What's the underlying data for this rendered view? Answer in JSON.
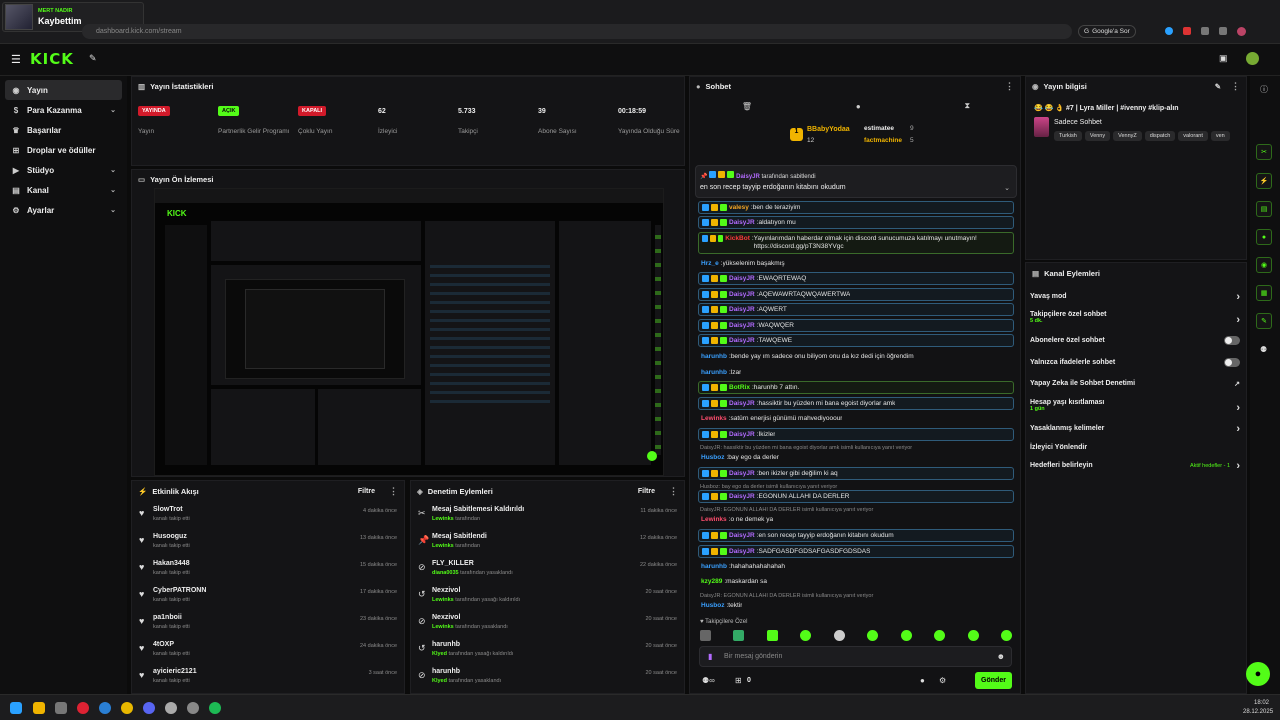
{
  "browser": {
    "url": "dashboard.kick.com/stream",
    "google_btn": "Google'a Sor",
    "media_card": {
      "artist": "MERT NADIR",
      "track": "Kaybettim"
    }
  },
  "topbar": {
    "logo": "KICK"
  },
  "sidebar": {
    "items": [
      {
        "label": "Yayın",
        "icon": "broadcast-icon",
        "active": true
      },
      {
        "label": "Para Kazanma",
        "icon": "dollar-icon",
        "chevron": true
      },
      {
        "label": "Başarılar",
        "icon": "trophy-icon"
      },
      {
        "label": "Droplar ve ödüller",
        "icon": "gift-icon"
      },
      {
        "label": "Stüdyo",
        "icon": "studio-icon",
        "chevron": true
      },
      {
        "label": "Kanal",
        "icon": "channel-icon",
        "chevron": true
      },
      {
        "label": "Ayarlar",
        "icon": "gear-icon",
        "chevron": true
      }
    ]
  },
  "stats": {
    "title": "Yayın İstatistikleri",
    "items": [
      {
        "value": "YAYINDA",
        "label": "Yayın",
        "badge": "red"
      },
      {
        "value": "AÇIK",
        "label": "Partnerlik Gelir Programı",
        "badge": "green"
      },
      {
        "value": "KAPALI",
        "label": "Çoklu Yayın",
        "badge": "red"
      },
      {
        "value": "62",
        "label": "İzleyici"
      },
      {
        "value": "5.733",
        "label": "Takipçi"
      },
      {
        "value": "39",
        "label": "Abone Sayısı"
      },
      {
        "value": "00:18:59",
        "label": "Yayında Olduğu Süre"
      }
    ]
  },
  "preview": {
    "title": "Yayın Ön İzlemesi"
  },
  "activity": {
    "title": "Etkinlik Akışı",
    "filter": "Filtre",
    "rows": [
      {
        "name": "SlowTrot",
        "sub": "kanalı takip etti",
        "time": "4 dakika önce"
      },
      {
        "name": "Husooguz",
        "sub": "kanalı takip etti",
        "time": "13 dakika önce"
      },
      {
        "name": "Hakan3448",
        "sub": "kanalı takip etti",
        "time": "15 dakika önce"
      },
      {
        "name": "CyberPATRONN",
        "sub": "kanalı takip etti",
        "time": "17 dakika önce"
      },
      {
        "name": "pa1nboii",
        "sub": "kanalı takip etti",
        "time": "23 dakika önce"
      },
      {
        "name": "4tOXP",
        "sub": "kanalı takip etti",
        "time": "24 dakika önce"
      },
      {
        "name": "ayicieric2121",
        "sub": "kanalı takip etti",
        "time": "3 saat önce"
      }
    ]
  },
  "moderation": {
    "title": "Denetim Eylemleri",
    "filter": "Filtre",
    "rows": [
      {
        "icon": "pin-off-icon",
        "title": "Mesaj Sabitlemesi Kaldırıldı",
        "user": "Lewinks",
        "sub": "tarafından",
        "time": "11 dakika önce"
      },
      {
        "icon": "pin-icon",
        "title": "Mesaj Sabitlendi",
        "user": "Lewinks",
        "sub": "tarafından",
        "time": "12 dakika önce"
      },
      {
        "icon": "ban-icon",
        "title": "FLY_KILLER",
        "user": "diana0035",
        "sub": "tarafından yasaklandı",
        "time": "22 dakika önce"
      },
      {
        "icon": "undo-icon",
        "title": "Nexzivol",
        "user": "Lewinks",
        "sub": "tarafından yasağı kaldırıldı",
        "time": "20 saat önce"
      },
      {
        "icon": "ban-icon",
        "title": "Nexzivol",
        "user": "Lewinks",
        "sub": "tarafından yasaklandı",
        "time": "20 saat önce"
      },
      {
        "icon": "undo-icon",
        "title": "harunhb",
        "user": "Klyed",
        "sub": "tarafından yasağı kaldırıldı",
        "time": "20 saat önce"
      },
      {
        "icon": "ban-icon",
        "title": "harunhb",
        "user": "Klyed",
        "sub": "tarafından yasaklandı",
        "time": "20 saat önce"
      }
    ]
  },
  "chat": {
    "title": "Sohbet",
    "leaders": [
      {
        "name": "BBabyYodaa",
        "count": "12"
      },
      {
        "name": "estimatee",
        "count": "9"
      },
      {
        "name": "factmachine",
        "count": "5"
      }
    ],
    "pinned": {
      "by": "DaisyJR",
      "label": "tarafından sabitlendi",
      "text": "en son recep tayyip erdoğanın kitabını okudum"
    },
    "lines": [
      {
        "user": "valesy",
        "color": "#f5a623",
        "text": "ben de teraziyim",
        "style": "box"
      },
      {
        "user": "DaisyJR",
        "color": "#b36bff",
        "text": "aldatıyon mu",
        "style": "box"
      },
      {
        "user": "KickBot",
        "color": "#ff3b3b",
        "text": "Yayınlarımdan haberdar olmak için discord sunucumuza katılmayı unutmayın! https://discord.gg/pT3N38YVgc",
        "style": "boxg"
      },
      {
        "user": "Hrz_e",
        "color": "#3aa0ff",
        "text": "yükselenim başakmış",
        "style": ""
      },
      {
        "user": "DaisyJR",
        "color": "#b36bff",
        "text": "EWAQRTEWAQ",
        "style": "box"
      },
      {
        "user": "DaisyJR",
        "color": "#b36bff",
        "text": "AQEWAWRTAQWQAWERTWA",
        "style": "box"
      },
      {
        "user": "DaisyJR",
        "color": "#b36bff",
        "text": "AQWERT",
        "style": "box"
      },
      {
        "user": "DaisyJR",
        "color": "#b36bff",
        "text": "WAQWQER",
        "style": "box"
      },
      {
        "user": "DaisyJR",
        "color": "#b36bff",
        "text": "TAWQEWE",
        "style": "box"
      },
      {
        "user": "harunhb",
        "color": "#3aa0ff",
        "text": "bende yay ım sadece onu biliyom onu da kız dedi için öğrendim",
        "style": ""
      },
      {
        "user": "harunhb",
        "color": "#3aa0ff",
        "text": "lzar",
        "style": ""
      },
      {
        "user": "BotRix",
        "color": "#53fc18",
        "text": "harunhb 7 attın.",
        "style": "boxg"
      },
      {
        "user": "DaisyJR",
        "color": "#b36bff",
        "text": "hassiktir bu yüzden mi bana egoist diyorlar amk",
        "style": "box"
      },
      {
        "user": "Lewinks",
        "color": "#ff4d6d",
        "text": "satürn enerjisi günümü mahvediyooour",
        "style": ""
      },
      {
        "user": "DaisyJR",
        "color": "#b36bff",
        "text": "İkizler",
        "style": "box"
      }
    ],
    "reply1": "DaisyJR: hassiktir bu yüzden mi bana egoist diyorlar amk isimli kullanıcıya yanıt veriyor",
    "line_husboz1": {
      "user": "Husboz",
      "text": "bay ego da derler"
    },
    "lines2": [
      {
        "user": "DaisyJR",
        "color": "#b36bff",
        "text": "ben ikizler gibi değilim ki aq",
        "style": "box"
      }
    ],
    "reply2": "Husboz: bay ego da derler isimli kullanıcıya yanıt veriyor",
    "lines3": [
      {
        "user": "DaisyJR",
        "color": "#b36bff",
        "text": "EGONUN ALLAHI DA DERLER",
        "style": "box"
      }
    ],
    "reply3": "DaisyJR: EGONUN ALLAHI DA DERLER isimli kullanıcıya yanıt veriyor",
    "lines4": [
      {
        "user": "Lewinks",
        "color": "#ff4d6d",
        "text": "o ne demek ya",
        "style": ""
      },
      {
        "user": "DaisyJR",
        "color": "#b36bff",
        "text": "en son recep tayyip erdoğanın kitabını okudum",
        "style": "box"
      },
      {
        "user": "DaisyJR",
        "color": "#b36bff",
        "text": "SADFGASDFGDSAFGASDFGDSDAS",
        "style": "box"
      },
      {
        "user": "harunhb",
        "color": "#3aa0ff",
        "text": "hahahahahahahah",
        "style": ""
      },
      {
        "user": "kzy289",
        "color": "#53fc18",
        "text": "maskardan sa",
        "style": ""
      }
    ],
    "reply4": "DaisyJR: EGONUN ALLAHI DA DERLER isimli kullanıcıya yanıt veriyor",
    "line_husboz2": {
      "user": "Husboz",
      "text": "tektir"
    },
    "followers_only": "Takipçilere Özel",
    "input_placeholder": "Bir mesaj gönderin",
    "send": "Gönder",
    "footer_count": "0"
  },
  "stream_info": {
    "title": "Yayın bilgisi",
    "stream_title": "😂 😂 👌 #7 | Lyra Miller | #ivenny #klip-alın",
    "category": "Sadece Sohbet",
    "tags": [
      "Turkish",
      "Venny",
      "VennyZ",
      "dispatch",
      "valorant",
      "ven"
    ]
  },
  "channel_actions": {
    "title": "Kanal Eylemleri",
    "items": [
      {
        "label": "Yavaş mod",
        "type": "arrow"
      },
      {
        "label": "Takipçilere özel sohbet",
        "sub": "5 dk.",
        "type": "arrow"
      },
      {
        "label": "Abonelere özel sohbet",
        "type": "toggle"
      },
      {
        "label": "Yalnızca ifadelerle sohbet",
        "type": "toggle"
      },
      {
        "label": "Yapay Zeka ile Sohbet Denetimi",
        "type": "ext"
      },
      {
        "label": "Hesap yaşı kısıtlaması",
        "sub": "1 gün",
        "type": "arrow"
      },
      {
        "label": "Yasaklanmış kelimeler",
        "type": "arrow"
      },
      {
        "label": "İzleyici Yönlendir",
        "type": "none"
      },
      {
        "label": "Hedefleri belirleyin",
        "type": "arrow",
        "status": "Aktif hedefler - 1"
      }
    ]
  },
  "taskbar": {
    "time": "18:02",
    "date": "28.12.2025"
  }
}
